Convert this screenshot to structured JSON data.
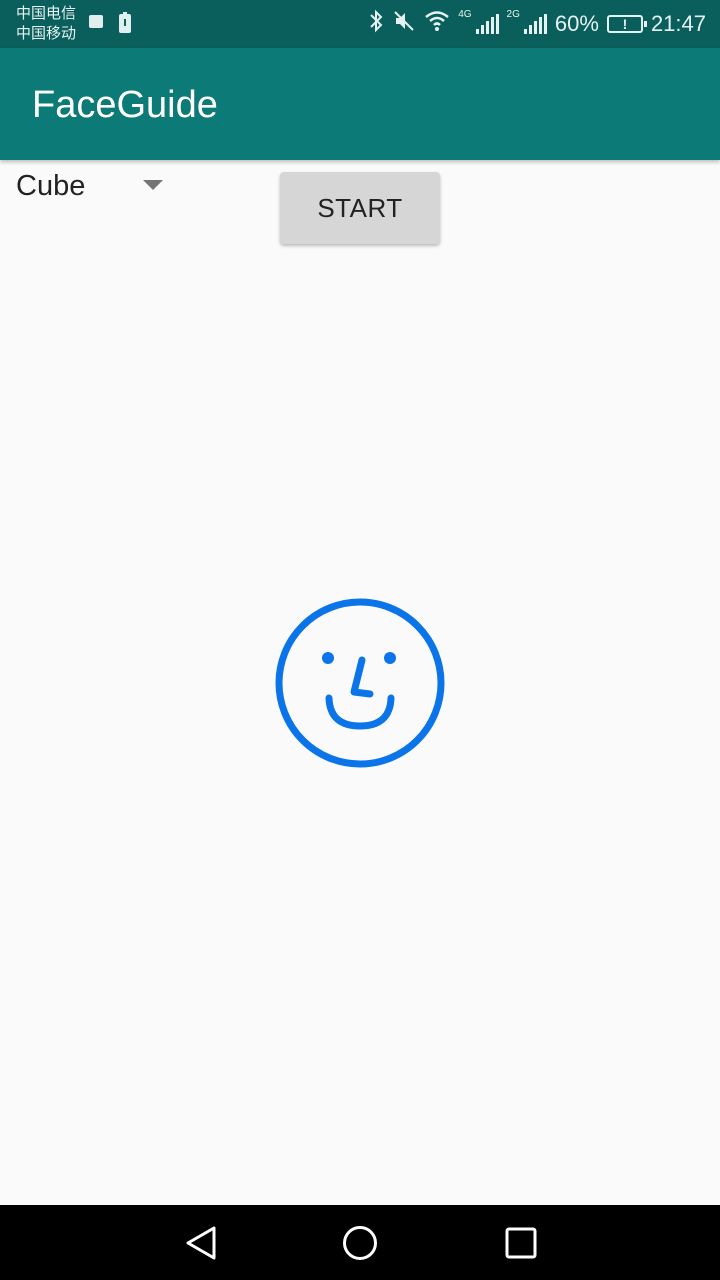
{
  "status_bar": {
    "carrier_1": "中国电信",
    "carrier_2": "中国移动",
    "net_4g": "4G",
    "net_2g": "2G",
    "battery_percent": "60%",
    "time": "21:47"
  },
  "app_bar": {
    "title": "FaceGuide"
  },
  "controls": {
    "spinner_value": "Cube",
    "start_label": "START"
  },
  "colors": {
    "status_bar": "#0a5f5c",
    "app_bar": "#0c7a76",
    "accent_face": "#0a74e8",
    "button_bg": "#d6d6d6"
  },
  "icons": {
    "face": "smiley-face-icon",
    "back": "back-triangle-icon",
    "home": "home-circle-icon",
    "recents": "recents-square-icon"
  }
}
